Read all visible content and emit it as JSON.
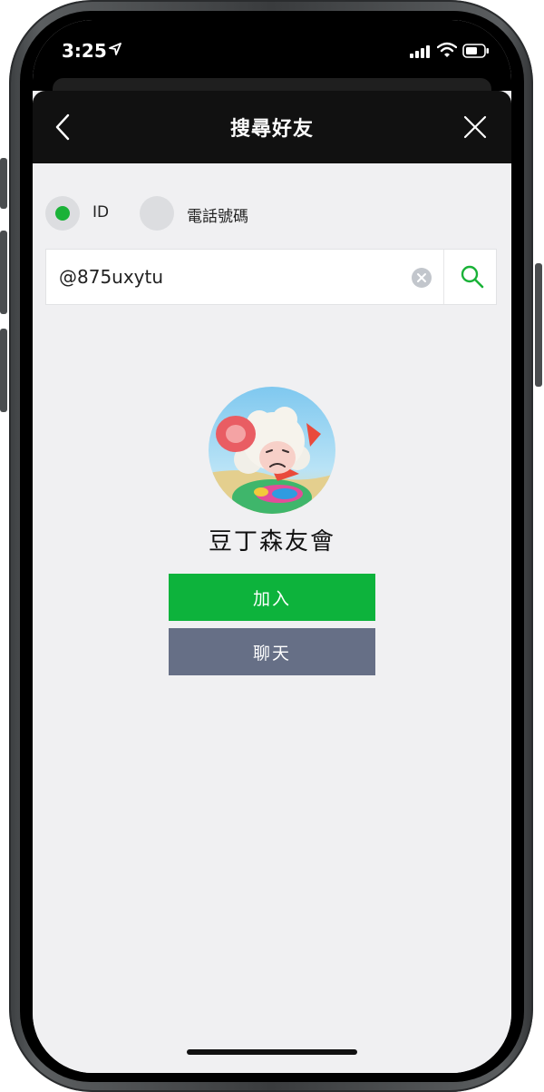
{
  "status_bar": {
    "time": "3:25"
  },
  "nav": {
    "title": "搜尋好友"
  },
  "search_type": {
    "options": [
      {
        "label": "ID",
        "selected": true
      },
      {
        "label": "電話號碼",
        "selected": false
      }
    ]
  },
  "search": {
    "value": "@875uxytu"
  },
  "result": {
    "name": "豆丁森友會",
    "add_label": "加入",
    "chat_label": "聊天"
  },
  "colors": {
    "accent_green": "#0db33c",
    "chat_button": "#666f86",
    "nav_background": "#111111",
    "page_background": "#f0f0f2"
  },
  "icons": [
    "back-icon",
    "close-icon",
    "clear-icon",
    "search-icon",
    "location-arrow-icon",
    "signal-icon",
    "wifi-icon",
    "battery-icon"
  ]
}
